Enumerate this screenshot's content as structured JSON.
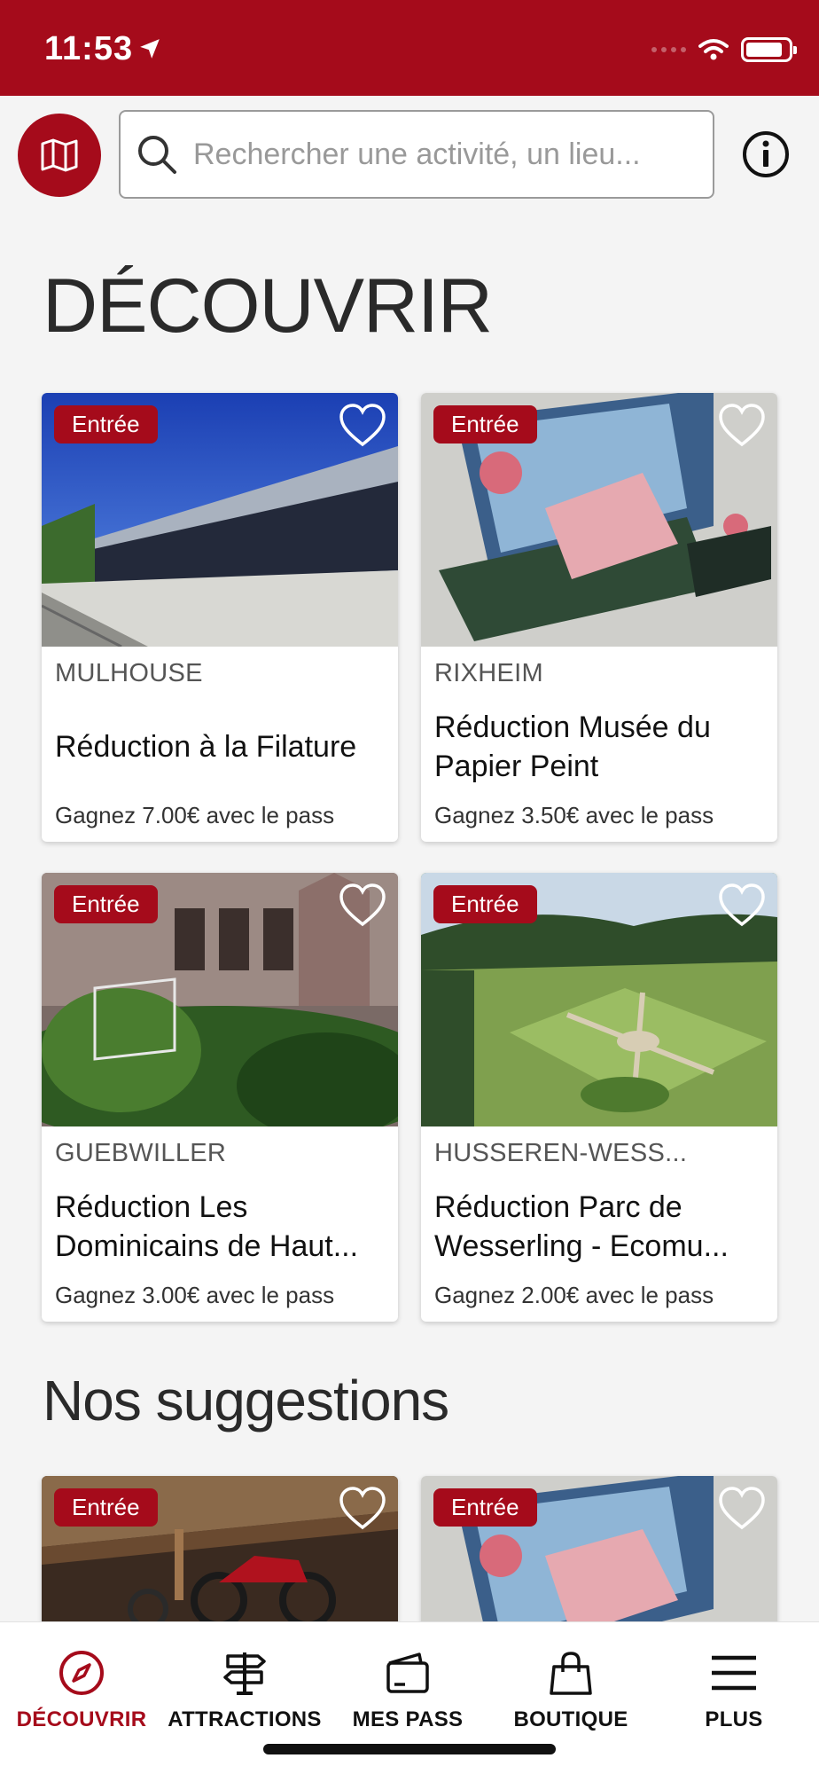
{
  "status_bar": {
    "time": "11:53"
  },
  "search": {
    "placeholder": "Rechercher une activité, un lieu..."
  },
  "sections": {
    "discover_title": "DÉCOUVRIR",
    "suggestions_title": "Nos suggestions"
  },
  "cards": [
    {
      "badge": "Entrée",
      "city": "MULHOUSE",
      "title": "Réduction à la Filature",
      "gain": "Gagnez 7.00€ avec le pass"
    },
    {
      "badge": "Entrée",
      "city": "RIXHEIM",
      "title": "Réduction Musée du Papier Peint",
      "gain": "Gagnez 3.50€ avec le pass"
    },
    {
      "badge": "Entrée",
      "city": "GUEBWILLER",
      "title": "Réduction Les Dominicains de Haut...",
      "gain": "Gagnez 3.00€ avec le pass"
    },
    {
      "badge": "Entrée",
      "city": "HUSSEREN-WESS...",
      "title": "Réduction Parc de Wesserling - Ecomu...",
      "gain": "Gagnez 2.00€ avec le pass"
    }
  ],
  "suggestions": [
    {
      "badge": "Entrée"
    },
    {
      "badge": "Entrée"
    }
  ],
  "tabs": [
    {
      "label": "DÉCOUVRIR",
      "icon": "compass-icon",
      "active": true
    },
    {
      "label": "ATTRACTIONS",
      "icon": "signpost-icon"
    },
    {
      "label": "MES PASS",
      "icon": "wallet-icon"
    },
    {
      "label": "BOUTIQUE",
      "icon": "shopping-bag-icon"
    },
    {
      "label": "PLUS",
      "icon": "menu-icon"
    }
  ],
  "colors": {
    "brand": "#a50b1b",
    "background": "#f4f4f4"
  }
}
